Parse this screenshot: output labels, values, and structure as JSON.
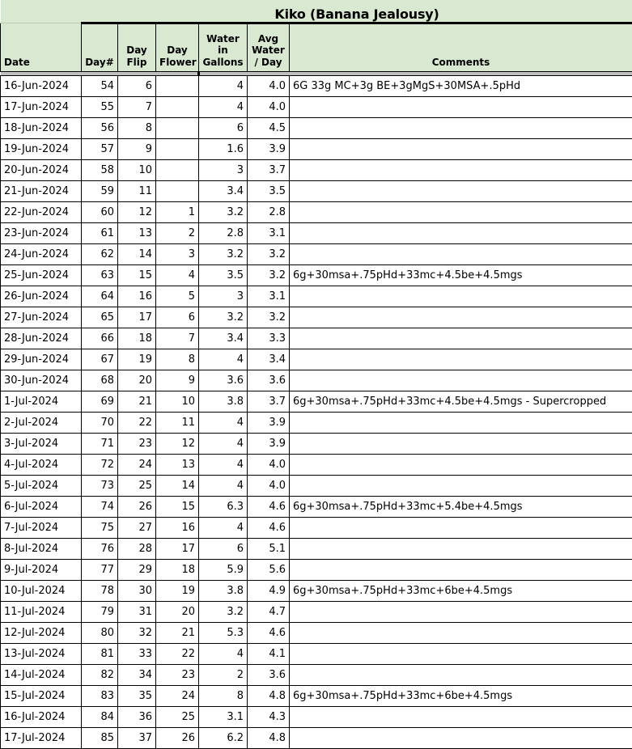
{
  "sheet": {
    "title": "Kiko (Banana Jealousy)",
    "colors": {
      "header_background": "#d9e8d0",
      "avg_column_background": "#ebebeb",
      "separator_band": "#bfbfbf",
      "grid_line": "#000000"
    },
    "headers": {
      "date": "Date",
      "day_number": "Day#",
      "day_flip": "Day\nFlip",
      "day_flower": "Day\nFlower",
      "water_in_gallons": "Water\nin\nGallons",
      "avg_water_per_day": "Avg\nWater\n/ Day",
      "comments": "Comments"
    },
    "header_lines": {
      "day_flip": [
        "Day",
        "Flip"
      ],
      "day_flower": [
        "Day",
        "Flower"
      ],
      "water_in_gallons": [
        "Water",
        "in",
        "Gallons"
      ],
      "avg_water_per_day": [
        "Avg",
        "Water",
        "/ Day"
      ]
    },
    "rows": [
      {
        "date": "16-Jun-2024",
        "day": "54",
        "flip": "6",
        "flower": "",
        "water": "4",
        "avg": "4.0",
        "comments": "6G 33g MC+3g BE+3gMgS+30MSA+.5pHd"
      },
      {
        "date": "17-Jun-2024",
        "day": "55",
        "flip": "7",
        "flower": "",
        "water": "4",
        "avg": "4.0",
        "comments": ""
      },
      {
        "date": "18-Jun-2024",
        "day": "56",
        "flip": "8",
        "flower": "",
        "water": "6",
        "avg": "4.5",
        "comments": ""
      },
      {
        "date": "19-Jun-2024",
        "day": "57",
        "flip": "9",
        "flower": "",
        "water": "1.6",
        "avg": "3.9",
        "comments": ""
      },
      {
        "date": "20-Jun-2024",
        "day": "58",
        "flip": "10",
        "flower": "",
        "water": "3",
        "avg": "3.7",
        "comments": ""
      },
      {
        "date": "21-Jun-2024",
        "day": "59",
        "flip": "11",
        "flower": "",
        "water": "3.4",
        "avg": "3.5",
        "comments": ""
      },
      {
        "date": "22-Jun-2024",
        "day": "60",
        "flip": "12",
        "flower": "1",
        "water": "3.2",
        "avg": "2.8",
        "comments": ""
      },
      {
        "date": "23-Jun-2024",
        "day": "61",
        "flip": "13",
        "flower": "2",
        "water": "2.8",
        "avg": "3.1",
        "comments": ""
      },
      {
        "date": "24-Jun-2024",
        "day": "62",
        "flip": "14",
        "flower": "3",
        "water": "3.2",
        "avg": "3.2",
        "comments": ""
      },
      {
        "date": "25-Jun-2024",
        "day": "63",
        "flip": "15",
        "flower": "4",
        "water": "3.5",
        "avg": "3.2",
        "comments": "6g+30msa+.75pHd+33mc+4.5be+4.5mgs"
      },
      {
        "date": "26-Jun-2024",
        "day": "64",
        "flip": "16",
        "flower": "5",
        "water": "3",
        "avg": "3.1",
        "comments": ""
      },
      {
        "date": "27-Jun-2024",
        "day": "65",
        "flip": "17",
        "flower": "6",
        "water": "3.2",
        "avg": "3.2",
        "comments": ""
      },
      {
        "date": "28-Jun-2024",
        "day": "66",
        "flip": "18",
        "flower": "7",
        "water": "3.4",
        "avg": "3.3",
        "comments": ""
      },
      {
        "date": "29-Jun-2024",
        "day": "67",
        "flip": "19",
        "flower": "8",
        "water": "4",
        "avg": "3.4",
        "comments": ""
      },
      {
        "date": "30-Jun-2024",
        "day": "68",
        "flip": "20",
        "flower": "9",
        "water": "3.6",
        "avg": "3.6",
        "comments": ""
      },
      {
        "date": "1-Jul-2024",
        "day": "69",
        "flip": "21",
        "flower": "10",
        "water": "3.8",
        "avg": "3.7",
        "comments": "6g+30msa+.75pHd+33mc+4.5be+4.5mgs - Supercropped"
      },
      {
        "date": "2-Jul-2024",
        "day": "70",
        "flip": "22",
        "flower": "11",
        "water": "4",
        "avg": "3.9",
        "comments": ""
      },
      {
        "date": "3-Jul-2024",
        "day": "71",
        "flip": "23",
        "flower": "12",
        "water": "4",
        "avg": "3.9",
        "comments": ""
      },
      {
        "date": "4-Jul-2024",
        "day": "72",
        "flip": "24",
        "flower": "13",
        "water": "4",
        "avg": "4.0",
        "comments": ""
      },
      {
        "date": "5-Jul-2024",
        "day": "73",
        "flip": "25",
        "flower": "14",
        "water": "4",
        "avg": "4.0",
        "comments": ""
      },
      {
        "date": "6-Jul-2024",
        "day": "74",
        "flip": "26",
        "flower": "15",
        "water": "6.3",
        "avg": "4.6",
        "comments": "6g+30msa+.75pHd+33mc+5.4be+4.5mgs"
      },
      {
        "date": "7-Jul-2024",
        "day": "75",
        "flip": "27",
        "flower": "16",
        "water": "4",
        "avg": "4.6",
        "comments": ""
      },
      {
        "date": "8-Jul-2024",
        "day": "76",
        "flip": "28",
        "flower": "17",
        "water": "6",
        "avg": "5.1",
        "comments": ""
      },
      {
        "date": "9-Jul-2024",
        "day": "77",
        "flip": "29",
        "flower": "18",
        "water": "5.9",
        "avg": "5.6",
        "comments": ""
      },
      {
        "date": "10-Jul-2024",
        "day": "78",
        "flip": "30",
        "flower": "19",
        "water": "3.8",
        "avg": "4.9",
        "comments": "6g+30msa+.75pHd+33mc+6be+4.5mgs"
      },
      {
        "date": "11-Jul-2024",
        "day": "79",
        "flip": "31",
        "flower": "20",
        "water": "3.2",
        "avg": "4.7",
        "comments": ""
      },
      {
        "date": "12-Jul-2024",
        "day": "80",
        "flip": "32",
        "flower": "21",
        "water": "5.3",
        "avg": "4.6",
        "comments": ""
      },
      {
        "date": "13-Jul-2024",
        "day": "81",
        "flip": "33",
        "flower": "22",
        "water": "4",
        "avg": "4.1",
        "comments": ""
      },
      {
        "date": "14-Jul-2024",
        "day": "82",
        "flip": "34",
        "flower": "23",
        "water": "2",
        "avg": "3.6",
        "comments": ""
      },
      {
        "date": "15-Jul-2024",
        "day": "83",
        "flip": "35",
        "flower": "24",
        "water": "8",
        "avg": "4.8",
        "comments": "6g+30msa+.75pHd+33mc+6be+4.5mgs"
      },
      {
        "date": "16-Jul-2024",
        "day": "84",
        "flip": "36",
        "flower": "25",
        "water": "3.1",
        "avg": "4.3",
        "comments": ""
      },
      {
        "date": "17-Jul-2024",
        "day": "85",
        "flip": "37",
        "flower": "26",
        "water": "6.2",
        "avg": "4.8",
        "comments": ""
      }
    ]
  }
}
